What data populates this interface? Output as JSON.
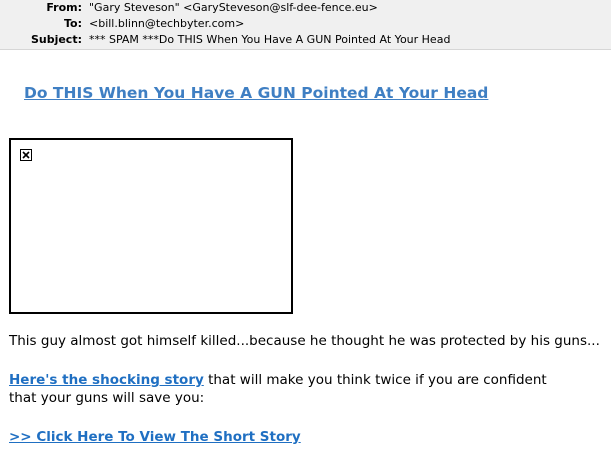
{
  "header": {
    "from_label": "From:",
    "from_value": "\"Gary Steveson\" <GarySteveson@slf-dee-fence.eu>",
    "to_label": "To:",
    "to_value": "<bill.blinn@techbyter.com>",
    "subject_label": "Subject:",
    "subject_value": "*** SPAM ***Do THIS When You Have A GUN Pointed At Your Head"
  },
  "body": {
    "headline_link": "Do THIS When You Have A GUN Pointed At Your Head",
    "paragraph1": "This guy almost got himself killed...because he thought he was protected by his guns...",
    "story_link": "Here's the shocking story",
    "paragraph2_rest": " that will make you think twice if you are confident",
    "paragraph2_line2": "that your guns will save you:",
    "cta_link": ">> Click Here To View The Short Story"
  },
  "colors": {
    "headline_link": "#3f7fc3",
    "inline_link": "#1f6fc2",
    "header_bg": "#f0f0f0"
  },
  "icons": {
    "broken_image": "broken-image-icon"
  }
}
